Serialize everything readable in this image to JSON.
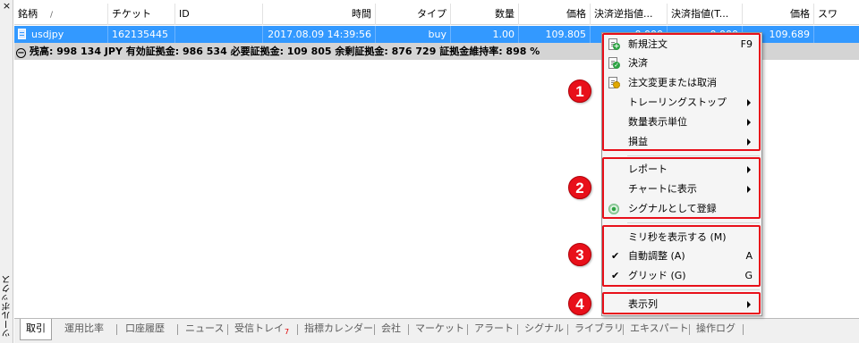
{
  "toolbox": {
    "title": "ツールボックス",
    "close_glyph": "×"
  },
  "table": {
    "headers": [
      "銘柄",
      "チケット",
      "ID",
      "時間",
      "タイプ",
      "数量",
      "価格",
      "決済逆指値...",
      "決済指値(T...",
      "価格",
      "スワ"
    ],
    "sort_glyph": "/",
    "row": {
      "symbol": "usdjpy",
      "ticket": "162135445",
      "id": "",
      "time": "2017.08.09 14:39:56",
      "type": "buy",
      "volume": "1.00",
      "price": "109.805",
      "sl": "0.000",
      "tp": "0.000",
      "current_price": "109.689",
      "swap": ""
    },
    "balance_line": "残高: 998 134 JPY  有効証拠金: 986 534  必要証拠金: 109 805  余剰証拠金: 876 729  証拠金維持率: 898 %"
  },
  "tabs": [
    {
      "label": "取引",
      "active": true
    },
    {
      "label": "運用比率"
    },
    {
      "label": "口座履歴"
    },
    {
      "label": "ニュース"
    },
    {
      "label": "受信トレイ",
      "badge": "7"
    },
    {
      "label": "指標カレンダー"
    },
    {
      "label": "会社"
    },
    {
      "label": "マーケット"
    },
    {
      "label": "アラート"
    },
    {
      "label": "シグナル"
    },
    {
      "label": "ライブラリ"
    },
    {
      "label": "エキスパート"
    },
    {
      "label": "操作ログ"
    }
  ],
  "context_menu": {
    "items": [
      {
        "label": "新規注文",
        "shortcut": "F9",
        "icon": "new-order-icon"
      },
      {
        "label": "決済",
        "icon": "close-order-icon"
      },
      {
        "label": "注文変更または取消",
        "icon": "modify-order-icon"
      },
      {
        "label": "トレーリングストップ",
        "submenu": true
      },
      {
        "label": "数量表示単位",
        "submenu": true
      },
      {
        "label": "損益",
        "submenu": true
      },
      {
        "label": "レポート",
        "submenu": true
      },
      {
        "label": "チャートに表示",
        "submenu": true
      },
      {
        "label": "シグナルとして登録",
        "icon": "signal-icon"
      },
      {
        "label": "ミリ秒を表示する (M)"
      },
      {
        "label": "自動調整 (A)",
        "shortcut": "A",
        "checked": true
      },
      {
        "label": "グリッド (G)",
        "shortcut": "G",
        "checked": true
      },
      {
        "label": "表示列",
        "submenu": true
      }
    ],
    "check_glyph": "✔"
  },
  "annotations": [
    "1",
    "2",
    "3",
    "4"
  ],
  "colors": {
    "selection": "#3399ff",
    "annotation_red": "#e8101a",
    "balance_bg": "#d4d4d4"
  }
}
